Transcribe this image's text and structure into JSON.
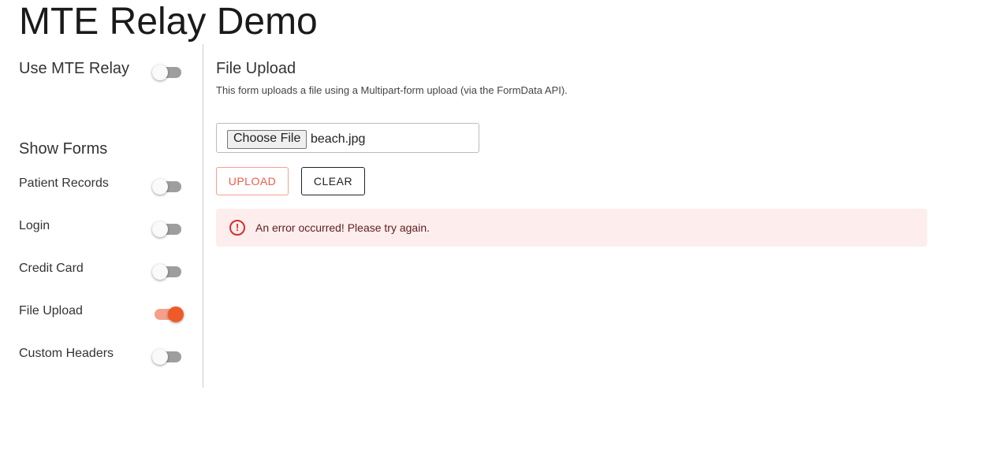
{
  "title": "MTE Relay Demo",
  "sidebar": {
    "relay_label": "Use MTE Relay",
    "relay_on": false,
    "show_forms": "Show Forms",
    "items": [
      {
        "label": "Patient Records",
        "on": false
      },
      {
        "label": "Login",
        "on": false
      },
      {
        "label": "Credit Card",
        "on": false
      },
      {
        "label": "File Upload",
        "on": true
      },
      {
        "label": "Custom Headers",
        "on": false
      }
    ]
  },
  "main": {
    "title": "File Upload",
    "description": "This form uploads a file using a Multipart-form upload (via the FormData API).",
    "choose_file": "Choose File",
    "file_name": "beach.jpg",
    "upload": "UPLOAD",
    "clear": "CLEAR",
    "error": "An error occurred! Please try again.",
    "error_icon": "error-outline-icon"
  },
  "colors": {
    "accent": "#f05a28",
    "error_bg": "#fdeded"
  }
}
